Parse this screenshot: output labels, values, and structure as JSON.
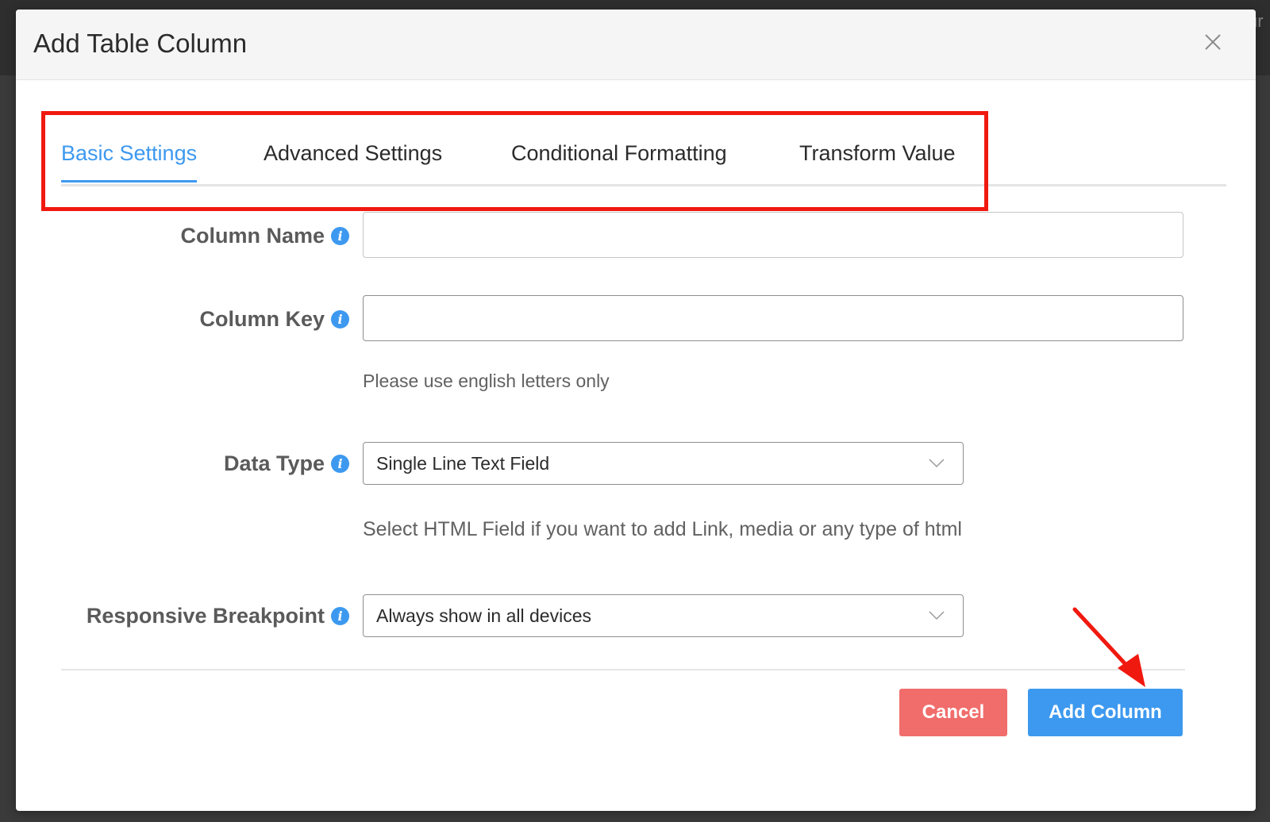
{
  "background": {
    "partial_text": "ur"
  },
  "modal": {
    "title": "Add Table Column",
    "close_icon": "close-icon"
  },
  "tabs": [
    {
      "label": "Basic Settings",
      "active": true
    },
    {
      "label": "Advanced Settings",
      "active": false
    },
    {
      "label": "Conditional Formatting",
      "active": false
    },
    {
      "label": "Transform Value",
      "active": false
    }
  ],
  "form": {
    "column_name": {
      "label": "Column Name",
      "value": "",
      "placeholder": "",
      "icon": "info-icon"
    },
    "column_key": {
      "label": "Column Key",
      "value": "",
      "placeholder": "",
      "helper": "Please use english letters only",
      "icon": "info-icon"
    },
    "data_type": {
      "label": "Data Type",
      "selected": "Single Line Text Field",
      "helper": "Select HTML Field if you want to add Link, media or any type of html",
      "icon": "info-icon"
    },
    "responsive_breakpoint": {
      "label": "Responsive Breakpoint",
      "selected": "Always show in all devices",
      "icon": "info-icon"
    }
  },
  "footer": {
    "cancel_label": "Cancel",
    "submit_label": "Add Column"
  },
  "colors": {
    "accent": "#3d99ef",
    "danger": "#f06d6b",
    "annotation": "#f0190f"
  }
}
